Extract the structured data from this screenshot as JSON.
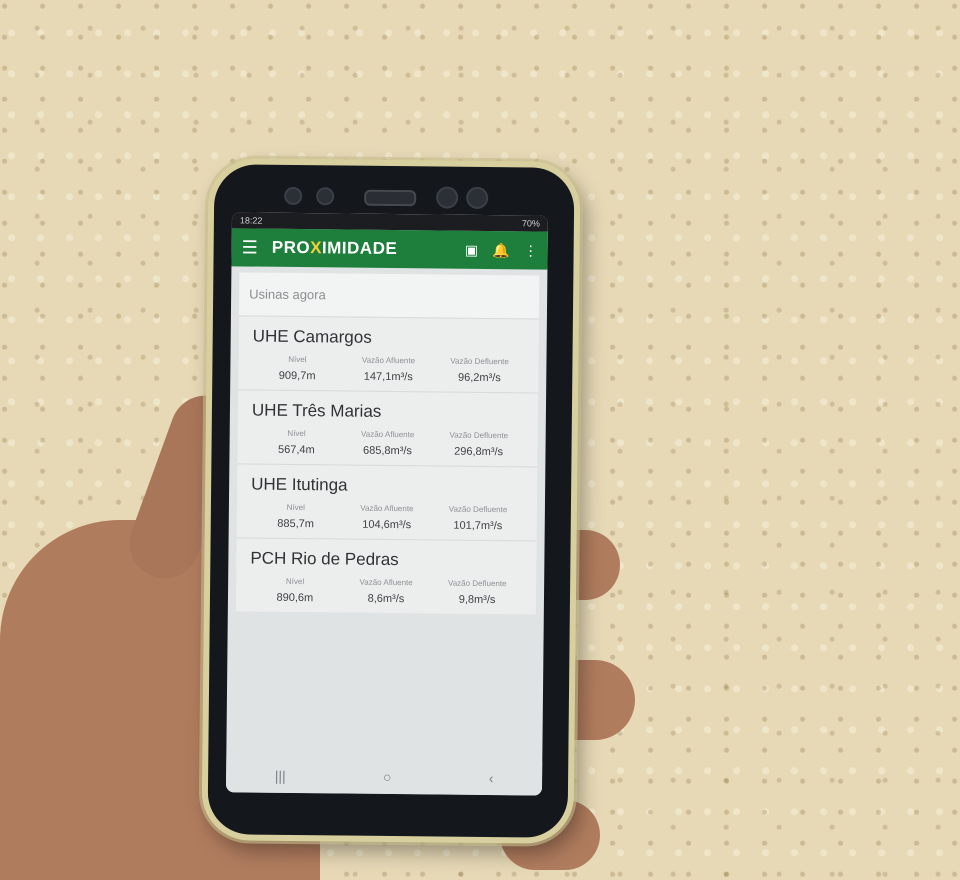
{
  "status": {
    "time": "18:22",
    "battery": "70%"
  },
  "app": {
    "brand_prefix": "PRO",
    "brand_x": "X",
    "brand_suffix": "IMIDADE"
  },
  "section_title": "Usinas agora",
  "labels": {
    "nivel": "Nível",
    "afluente": "Vazão Afluente",
    "defluente": "Vazão Defluente"
  },
  "plants": [
    {
      "name": "UHE Camargos",
      "nivel": "909,7m",
      "afluente": "147,1m³/s",
      "defluente": "96,2m³/s"
    },
    {
      "name": "UHE Três Marias",
      "nivel": "567,4m",
      "afluente": "685,8m³/s",
      "defluente": "296,8m³/s"
    },
    {
      "name": "UHE Itutinga",
      "nivel": "885,7m",
      "afluente": "104,6m³/s",
      "defluente": "101,7m³/s"
    },
    {
      "name": "PCH Rio de Pedras",
      "nivel": "890,6m",
      "afluente": "8,6m³/s",
      "defluente": "9,8m³/s"
    }
  ],
  "icons": [
    "menu-icon",
    "map-icon",
    "bell-icon",
    "more-icon",
    "recents-icon",
    "home-icon",
    "back-icon"
  ]
}
